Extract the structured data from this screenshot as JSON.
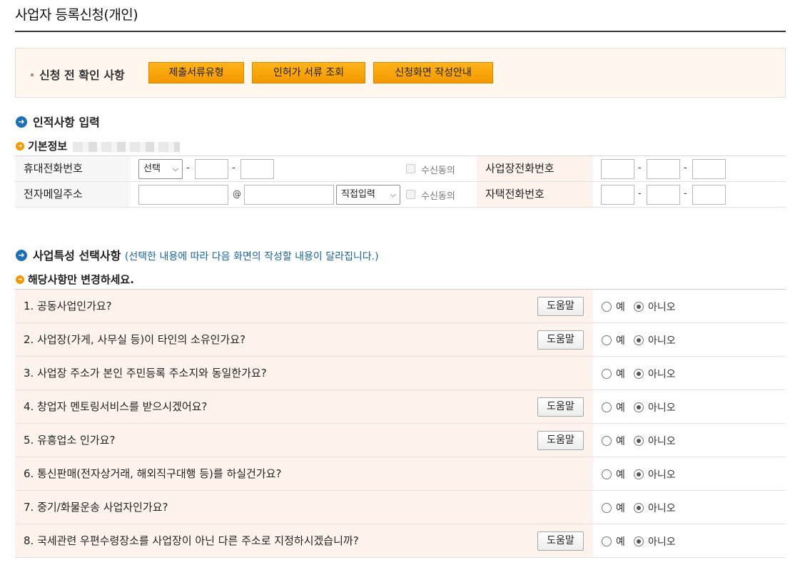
{
  "page": {
    "title": "사업자 등록신청(개인)"
  },
  "notice": {
    "label": "신청 전 확인 사항",
    "buttons": [
      "제출서류유형",
      "인허가 서류 조회",
      "신청화면 작성안내"
    ]
  },
  "identity_section": {
    "title": "인적사항 입력",
    "basic_info_label": "기본정보"
  },
  "contact": {
    "mobile_label": "휴대전화번호",
    "mobile_carrier_select": "선택",
    "dash": "-",
    "consent_label": "수신동의",
    "business_phone_label": "사업장전화번호",
    "email_label": "전자메일주소",
    "at_sign": "@",
    "email_domain_select": "직접입력",
    "home_phone_label": "자택전화번호"
  },
  "business_section": {
    "title": "사업특성 선택사항",
    "note": "(선택한 내용에 따라 다음 화면의 작성할 내용이 달라집니다.)",
    "sub_label": "해당사항만 변경하세요.",
    "help_label": "도움말",
    "yes_label": "예",
    "no_label": "아니오",
    "questions": [
      {
        "text": "1. 공동사업인가요?",
        "help": true,
        "answer": "no"
      },
      {
        "text": "2. 사업장(가게, 사무실 등)이 타인의 소유인가요?",
        "help": true,
        "answer": "no"
      },
      {
        "text": "3. 사업장 주소가 본인 주민등록 주소지와 동일한가요?",
        "help": false,
        "answer": "no"
      },
      {
        "text": "4. 창업자 멘토링서비스를 받으시겠어요?",
        "help": true,
        "answer": "no"
      },
      {
        "text": "5. 유흥업소 인가요?",
        "help": true,
        "answer": "no"
      },
      {
        "text": "6. 통신판매(전자상거래, 해외직구대행 등)를 하실건가요?",
        "help": false,
        "answer": "no"
      },
      {
        "text": "7. 중기/화물운송 사업자인가요?",
        "help": false,
        "answer": "no"
      },
      {
        "text": "8. 국세관련 우편수령장소를 사업장이 아닌 다른 주소로 지정하시겠습니까?",
        "help": true,
        "answer": "no"
      }
    ]
  },
  "colors": {
    "accent_orange": "#f39800",
    "section_blue": "#1f6fb4",
    "note_blue": "#19659c",
    "peach_bg": "#fdf3ec"
  },
  "icons": {
    "section_bullet": "arrow-circle-icon",
    "sub_bullet": "orange-arrow-icon"
  }
}
